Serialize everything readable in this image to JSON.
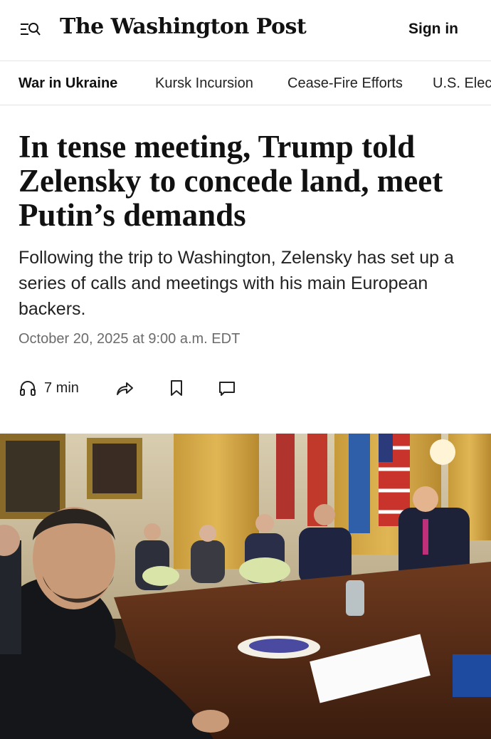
{
  "header": {
    "logo": "The Washington Post",
    "signin_label": "Sign in"
  },
  "nav": {
    "items": [
      {
        "label": "War in Ukraine",
        "active": true
      },
      {
        "label": "Kursk Incursion"
      },
      {
        "label": "Cease-Fire Efforts"
      },
      {
        "label": "U.S. Elec"
      }
    ]
  },
  "article": {
    "headline": "In tense meeting, Trump told Zelensky to concede land, meet Putin’s demands",
    "dek": "Following the trip to Washington, Zelensky has set up a series of calls and meetings with his main European backers.",
    "dateline": "October 20, 2025 at 9:00 a.m. EDT",
    "read_time": "7 min"
  },
  "icons": {
    "menu": "menu-search-icon",
    "listen": "headphones-icon",
    "share": "share-icon",
    "bookmark": "bookmark-icon",
    "comment": "comment-icon"
  },
  "colors": {
    "text": "#111111",
    "muted": "#6b6b6b",
    "divider": "#e4e4e4"
  }
}
